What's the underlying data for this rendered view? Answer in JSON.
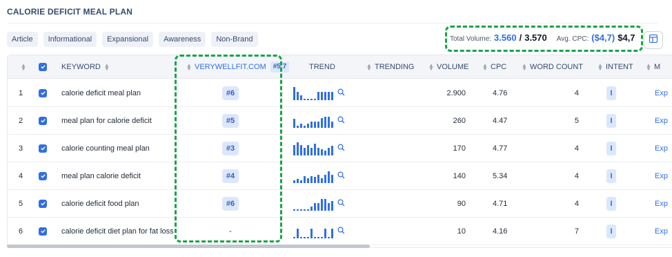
{
  "page": {
    "title": "CALORIE DEFICIT MEAL PLAN"
  },
  "tags": [
    "Article",
    "Informational",
    "Expansional",
    "Awareness",
    "Non-Brand"
  ],
  "summary": {
    "total_volume_label": "Total Volume:",
    "total_volume_value": "3.560",
    "total_volume_separator": "/",
    "total_volume_total": "3.570",
    "avg_cpc_label": "Avg. CPC:",
    "avg_cpc_value": "($4,7)",
    "avg_cpc_total": "$4,7"
  },
  "columns": {
    "keyword": "KEYWORD",
    "domain": "VERYWELLFIT.COM",
    "domain_badge": "#5.7",
    "trend": "TREND",
    "trending": "TRENDING",
    "volume": "VOLUME",
    "cpc": "CPC",
    "word_count": "WORD COUNT",
    "intent": "INTENT",
    "more": "M"
  },
  "rows": [
    {
      "num": "1",
      "keyword": "calorie deficit meal plan",
      "rank": "#6",
      "volume": "2.900",
      "cpc": "4.76",
      "words": "4",
      "intent": "I",
      "more": "Exp",
      "trend": [
        0.95,
        0.6,
        0.35,
        0.12,
        0.12,
        0.12,
        0.12,
        0.6,
        0.6,
        0.6,
        0.6,
        0.6
      ]
    },
    {
      "num": "2",
      "keyword": "meal plan for calorie deficit",
      "rank": "#5",
      "volume": "260",
      "cpc": "4.47",
      "words": "5",
      "intent": "I",
      "more": "Exp",
      "trend": [
        0.65,
        0.15,
        0.3,
        0.15,
        0.3,
        0.45,
        0.45,
        0.45,
        0.7,
        0.8,
        0.8,
        0.45
      ]
    },
    {
      "num": "3",
      "keyword": "calorie counting meal plan",
      "rank": "#3",
      "volume": "170",
      "cpc": "4.77",
      "words": "4",
      "intent": "I",
      "more": "Exp",
      "trend": [
        0.75,
        0.95,
        0.75,
        0.55,
        0.75,
        0.55,
        0.85,
        0.55,
        0.45,
        0.35,
        0.55,
        0.7
      ]
    },
    {
      "num": "4",
      "keyword": "meal plan calorie deficit",
      "rank": "#4",
      "volume": "140",
      "cpc": "5.34",
      "words": "4",
      "intent": "I",
      "more": "Exp",
      "trend": [
        0.2,
        0.3,
        0.2,
        0.5,
        0.35,
        0.5,
        0.45,
        0.6,
        0.35,
        0.6,
        0.85,
        0.6
      ]
    },
    {
      "num": "5",
      "keyword": "calorie deficit food plan",
      "rank": "#6",
      "volume": "90",
      "cpc": "4.71",
      "words": "4",
      "intent": "I",
      "more": "Exp",
      "trend": [
        0.1,
        0.1,
        0.1,
        0.1,
        0.1,
        0.3,
        0.55,
        0.55,
        0.85,
        0.85,
        0.55,
        0.7
      ]
    },
    {
      "num": "6",
      "keyword": "calorie deficit diet plan for fat loss",
      "rank": "-",
      "volume": "10",
      "cpc": "4.16",
      "words": "7",
      "intent": "I",
      "more": "Exp",
      "trend": [
        0.1,
        0.7,
        0.1,
        0.1,
        0.1,
        0.7,
        0.1,
        0.1,
        0.1,
        0.7,
        0.1,
        0.7
      ]
    }
  ],
  "colors": {
    "accent": "#2f6fe4",
    "highlight": "#16a34a"
  },
  "icons": {
    "layout": "table-layout-icon",
    "search": "search-icon",
    "check": "check-icon",
    "sort": "sort-icon"
  }
}
